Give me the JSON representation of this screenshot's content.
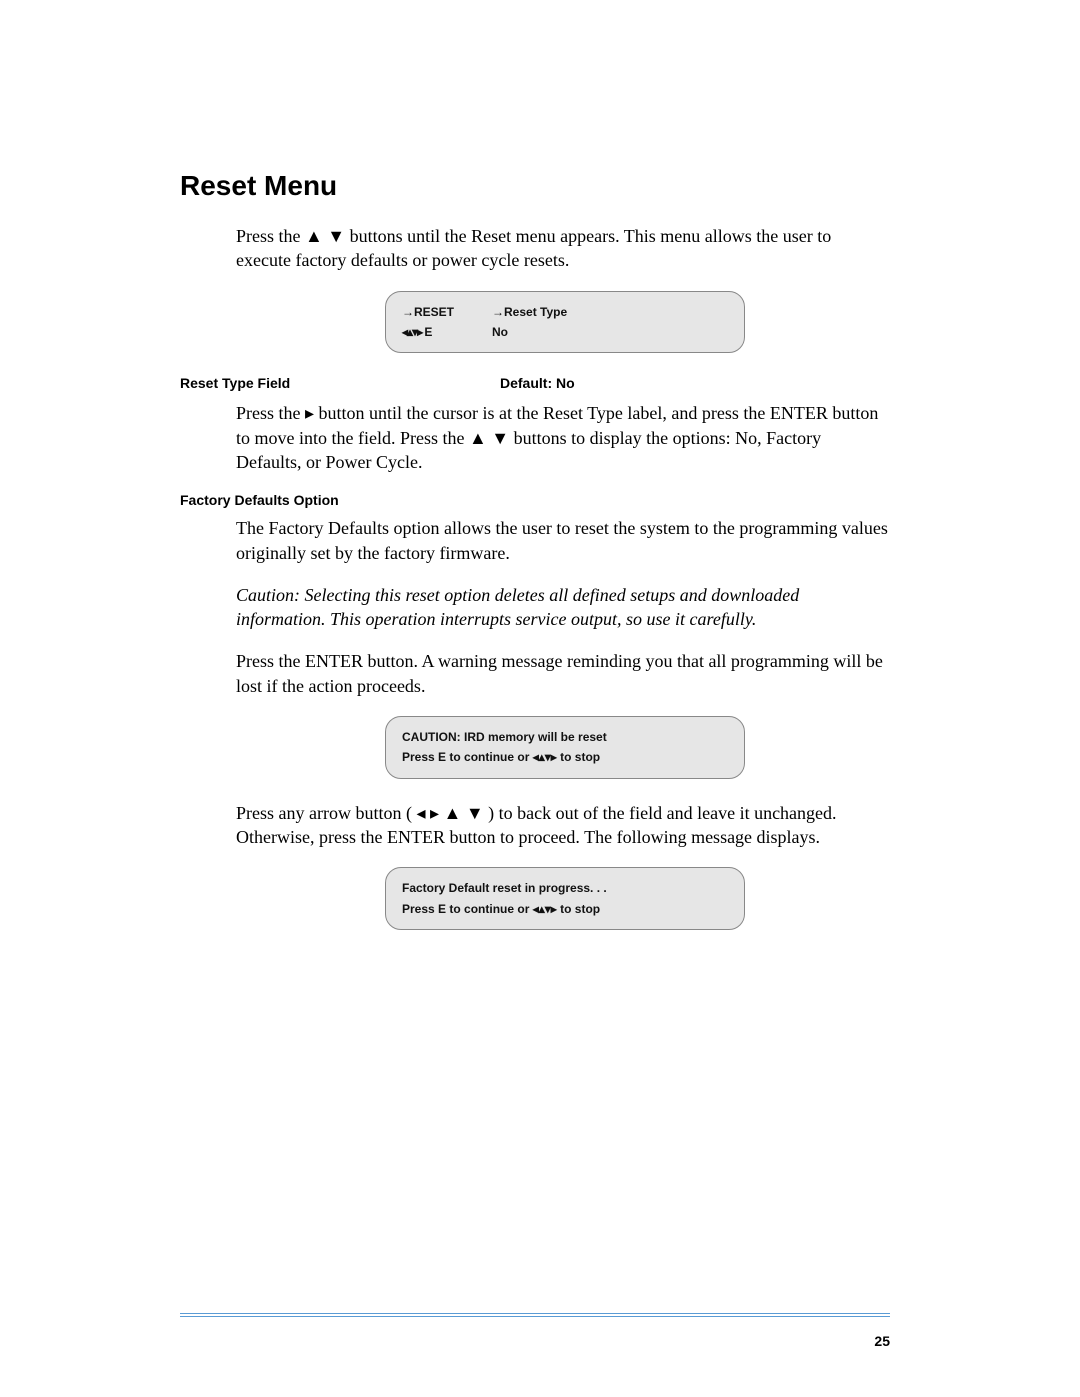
{
  "title": "Reset Menu",
  "intro_text": "Press the ▲ ▼ buttons until the Reset menu appears. This menu allows the user to execute factory defaults or power cycle resets.",
  "lcd_menu": {
    "row1_col1": "→RESET",
    "row1_col2": "→Reset Type",
    "row2_col1": "◂▴▾▸ E",
    "row2_col2": "No"
  },
  "reset_type_field": {
    "label": "Reset Type Field",
    "default": "Default: No",
    "text": "Press the ▸ button until the cursor is at the Reset Type label, and press the ENTER button to move into the field. Press the ▲ ▼ buttons to display the options: No, Factory Defaults, or Power Cycle."
  },
  "factory_defaults": {
    "label": "Factory Defaults Option",
    "text1": "The Factory Defaults option allows the user to reset the system to the programming values originally set by the factory firmware.",
    "caution": "Caution:  Selecting this reset option deletes all defined setups and downloaded information. This operation interrupts service output, so use it carefully.",
    "text2": "Press the ENTER button. A warning message reminding you that all programming will be lost if the action proceeds."
  },
  "lcd_caution": {
    "line1": "CAUTION: IRD memory will be reset",
    "line2": "Press E to continue or ◂▴▾▸ to stop"
  },
  "arrow_instr": "Press any arrow button ( ◂ ▸ ▲ ▼ ) to back out of the field and leave it unchanged. Otherwise, press the ENTER button to proceed. The following message displays.",
  "lcd_progress": {
    "line1": "Factory Default reset in progress. . .",
    "line2": "Press E to continue or ◂▴▾▸ to stop"
  },
  "page_number": "25"
}
